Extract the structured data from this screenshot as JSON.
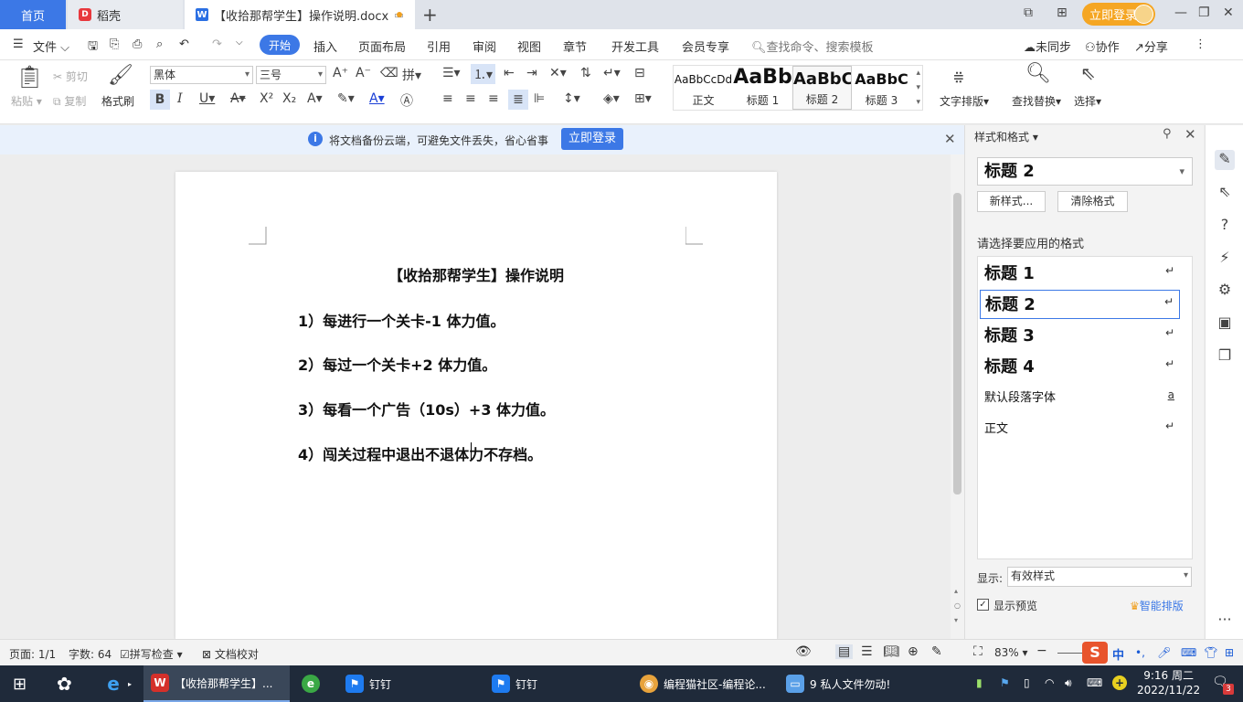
{
  "tabs": {
    "home": "首页",
    "daoke": "稻壳",
    "document": "【收拾那帮学生】操作说明.docx",
    "login": "立即登录"
  },
  "menu": {
    "file": "文件",
    "items": [
      "开始",
      "插入",
      "页面布局",
      "引用",
      "审阅",
      "视图",
      "章节",
      "开发工具",
      "会员专享"
    ],
    "search": "查找命令、搜索模板",
    "sync": "未同步",
    "collab": "协作",
    "share": "分享"
  },
  "ribbon": {
    "paste": "粘贴",
    "cut": "剪切",
    "copy": "复制",
    "format_painter": "格式刷",
    "font_name": "黑体",
    "font_size": "三号",
    "styles": [
      {
        "preview": "AaBbCcDd",
        "label": "正文"
      },
      {
        "preview": "AaBb",
        "label": "标题 1"
      },
      {
        "preview": "AaBbC",
        "label": "标题 2"
      },
      {
        "preview": "AaBbC",
        "label": "标题 3"
      }
    ],
    "text_layout": "文字排版",
    "find_replace": "查找替换",
    "select": "选择"
  },
  "infobar": {
    "message": "将文档备份云端，可避免文件丢失，省心省事",
    "login": "立即登录"
  },
  "document": {
    "title": "【收拾那帮学生】操作说明",
    "lines": [
      "1）每进行一个关卡-1 体力值。",
      "2）每过一个关卡+2 体力值。",
      "3）每看一个广告（10s）+3 体力值。",
      "4）闯关过程中退出不退体力不存档。"
    ]
  },
  "stylepane": {
    "title": "样式和格式",
    "current": "标题  2",
    "new_style": "新样式...",
    "clear_format": "清除格式",
    "hint": "请选择要应用的格式",
    "items": [
      "标题  1",
      "标题  2",
      "标题  3",
      "标题  4",
      "默认段落字体",
      "正文"
    ],
    "show_label": "显示:",
    "show_value": "有效样式",
    "preview_label": "显示预览",
    "smart": "智能排版"
  },
  "status": {
    "page": "页面: 1/1",
    "words": "字数: 64",
    "spell": "拼写检查",
    "proof": "文档校对",
    "zoom": "83%"
  },
  "taskbar": {
    "wps": "【收拾那帮学生】...",
    "dingtalk1": "钉钉",
    "dingtalk2": "钉钉",
    "chrome": "编程猫社区-编程论...",
    "files": "9 私人文件勿动!",
    "ime": "中",
    "time": "9:16 周二",
    "date": "2022/11/22",
    "badge": "3"
  }
}
